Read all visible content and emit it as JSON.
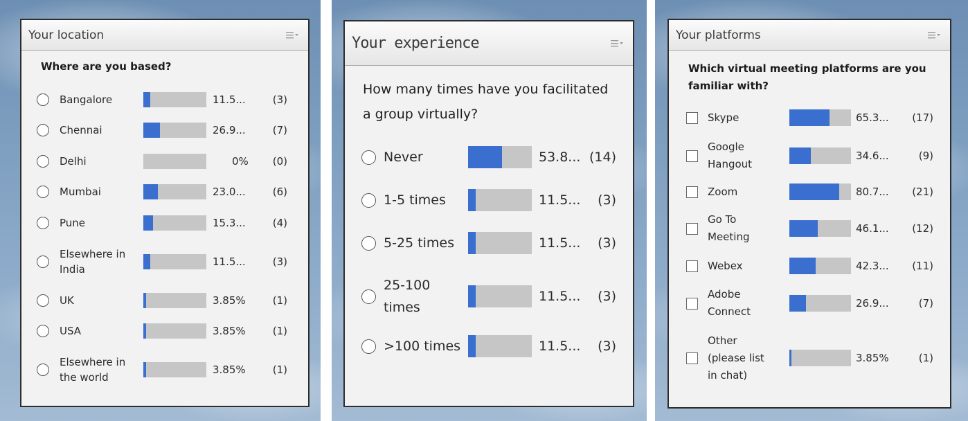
{
  "panels": [
    {
      "title": "Your location",
      "question": "Where are you based?",
      "control": "radio",
      "options": [
        {
          "label": "Bangalore",
          "fraction": 0.115,
          "percent_text": "11.5...",
          "count_text": "(3)"
        },
        {
          "label": "Chennai",
          "fraction": 0.269,
          "percent_text": "26.9...",
          "count_text": "(7)"
        },
        {
          "label": "Delhi",
          "fraction": 0,
          "percent_text": "0%",
          "count_text": "(0)"
        },
        {
          "label": "Mumbai",
          "fraction": 0.23,
          "percent_text": "23.0...",
          "count_text": "(6)"
        },
        {
          "label": "Pune",
          "fraction": 0.153,
          "percent_text": "15.3...",
          "count_text": "(4)"
        },
        {
          "label": "Elsewhere in\nIndia",
          "fraction": 0.115,
          "percent_text": "11.5...",
          "count_text": "(3)"
        },
        {
          "label": "UK",
          "fraction": 0.0385,
          "percent_text": "3.85%",
          "count_text": "(1)"
        },
        {
          "label": "USA",
          "fraction": 0.0385,
          "percent_text": "3.85%",
          "count_text": "(1)"
        },
        {
          "label": "Elsewhere in\nthe world",
          "fraction": 0.0385,
          "percent_text": "3.85%",
          "count_text": "(1)"
        }
      ]
    },
    {
      "title": "Your experience",
      "question": "How many times have you facilitated a group virtually?",
      "control": "radio",
      "options": [
        {
          "label": "Never",
          "fraction": 0.538,
          "percent_text": "53.8...",
          "count_text": "(14)"
        },
        {
          "label": "1-5 times",
          "fraction": 0.115,
          "percent_text": "11.5...",
          "count_text": "(3)"
        },
        {
          "label": "5-25 times",
          "fraction": 0.115,
          "percent_text": "11.5...",
          "count_text": "(3)"
        },
        {
          "label": "25-100\ntimes",
          "fraction": 0.115,
          "percent_text": "11.5...",
          "count_text": "(3)"
        },
        {
          "label": ">100 times",
          "fraction": 0.115,
          "percent_text": "11.5...",
          "count_text": "(3)"
        }
      ]
    },
    {
      "title": "Your platforms",
      "question": "Which virtual meeting platforms are you familiar with?",
      "control": "checkbox",
      "options": [
        {
          "label": "Skype",
          "fraction": 0.653,
          "percent_text": "65.3...",
          "count_text": "(17)"
        },
        {
          "label": "Google\nHangout",
          "fraction": 0.346,
          "percent_text": "34.6...",
          "count_text": "(9)"
        },
        {
          "label": "Zoom",
          "fraction": 0.807,
          "percent_text": "80.7...",
          "count_text": "(21)"
        },
        {
          "label": "Go To\nMeeting",
          "fraction": 0.461,
          "percent_text": "46.1...",
          "count_text": "(12)"
        },
        {
          "label": "Webex",
          "fraction": 0.423,
          "percent_text": "42.3...",
          "count_text": "(11)"
        },
        {
          "label": "Adobe\nConnect",
          "fraction": 0.269,
          "percent_text": "26.9...",
          "count_text": "(7)"
        },
        {
          "label": "Other\n(please list\nin chat)",
          "fraction": 0.0385,
          "percent_text": "3.85%",
          "count_text": "(1)"
        }
      ]
    }
  ],
  "colors": {
    "bar_fill": "#3a6fd0",
    "bar_track": "#c6c6c6",
    "panel_bg": "#f2f2f2"
  },
  "icons": {
    "menu": "hamburger-dropdown-icon",
    "radio": "radio-circle-icon",
    "checkbox": "checkbox-square-icon"
  }
}
